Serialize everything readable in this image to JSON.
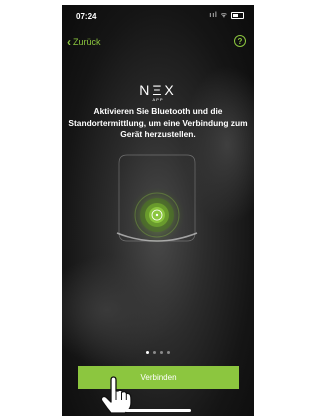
{
  "status_bar": {
    "time": "07:24",
    "icons": "ııl ᯤ"
  },
  "nav": {
    "back_label": "Zurück",
    "help_label": "?"
  },
  "logo": {
    "main": "NΞX",
    "sub": "APP"
  },
  "headline": "Aktivieren Sie Bluetooth und die Standortermittlung, um eine Verbindung zum Gerät herzustellen.",
  "pager": {
    "total": 4,
    "active_index": 0
  },
  "primary_button": {
    "label": "Verbinden"
  },
  "colors": {
    "accent": "#8cc63f",
    "background": "#151515",
    "text": "#ffffff"
  },
  "icons": [
    "chevron-left-icon",
    "help-icon",
    "nex-device-icon",
    "bluetooth-pulse-icon",
    "hand-pointer-icon"
  ]
}
